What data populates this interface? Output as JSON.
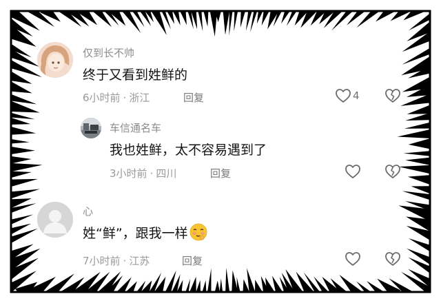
{
  "comments": [
    {
      "username": "仅到长不帅",
      "content": "终于又看到姓鲜的",
      "time": "6小时前",
      "location": "浙江",
      "reply_label": "回复",
      "likes": "4",
      "avatar": "illustrated-girl-avatar"
    },
    {
      "username": "车信通名车",
      "content": "我也姓鲜，太不容易遇到了",
      "time": "3小时前",
      "location": "四川",
      "reply_label": "回复",
      "avatar": "street-photo-avatar"
    },
    {
      "username": "心",
      "content": "姓“鲜”，跟我一样",
      "content_emoji": "blushing-face-emoji",
      "time": "7小时前",
      "location": "江苏",
      "reply_label": "回复",
      "avatar": "default-gray-avatar"
    }
  ],
  "colors": {
    "text_primary": "#141414",
    "text_secondary": "#9a9a9a",
    "icon": "#6b6b6b",
    "frame": "#000000",
    "emoji": "#f7c531"
  }
}
